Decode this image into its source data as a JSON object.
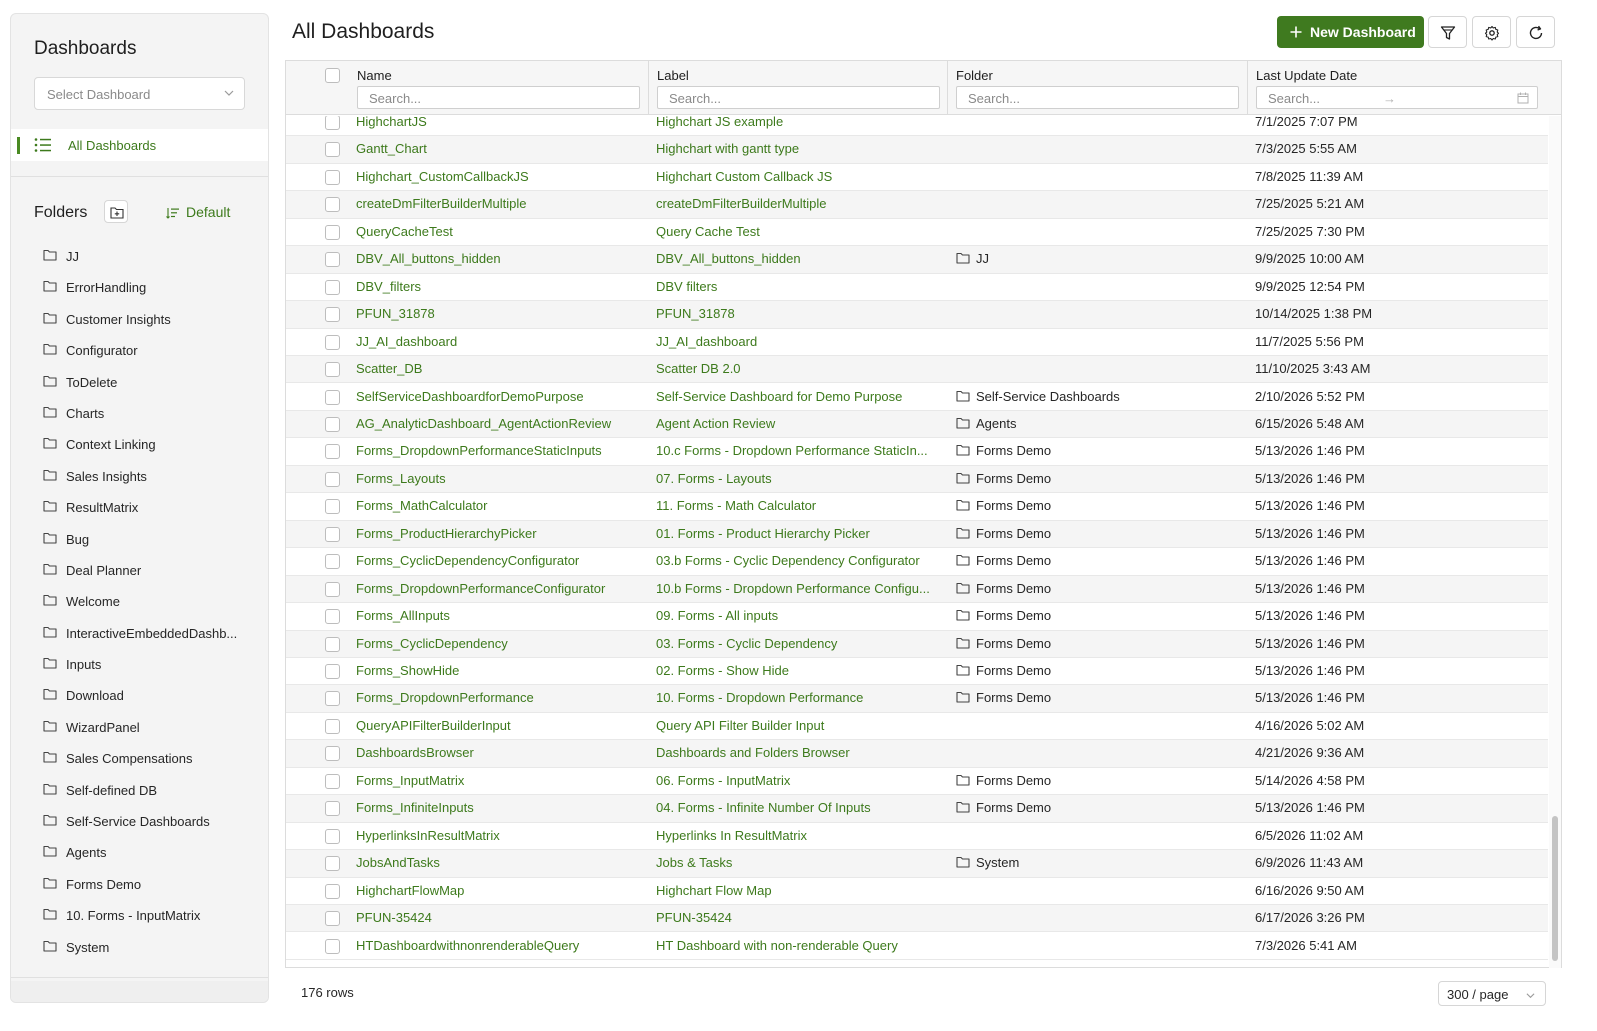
{
  "sidebar": {
    "title": "Dashboards",
    "select_placeholder": "Select Dashboard",
    "all_dashboards_label": "All Dashboards",
    "folders_title": "Folders",
    "sort_label": "Default",
    "folders": [
      "JJ",
      "ErrorHandling",
      "Customer Insights",
      "Configurator",
      "ToDelete",
      "Charts",
      "Context Linking",
      "Sales Insights",
      "ResultMatrix",
      "Bug",
      "Deal Planner",
      "Welcome",
      "InteractiveEmbeddedDashb...",
      "Inputs",
      "Download",
      "WizardPanel",
      "Sales Compensations",
      "Self-defined DB",
      "Self-Service Dashboards",
      "Agents",
      "Forms Demo",
      "10. Forms - InputMatrix",
      "System"
    ]
  },
  "main": {
    "title": "All Dashboards",
    "new_button_label": "New Dashboard",
    "columns": {
      "name": "Name",
      "label": "Label",
      "folder": "Folder",
      "date": "Last Update Date"
    },
    "search_placeholder": "Search...",
    "date_arrow": "→",
    "rows": [
      {
        "name": "HighchartJS",
        "label": "Highchart JS example",
        "folder": "",
        "date": "7/1/2025 7:07 PM"
      },
      {
        "name": "Gantt_Chart",
        "label": "Highchart with gantt type",
        "folder": "",
        "date": "7/3/2025 5:55 AM"
      },
      {
        "name": "Highchart_CustomCallbackJS",
        "label": "Highchart Custom Callback JS",
        "folder": "",
        "date": "7/8/2025 11:39 AM"
      },
      {
        "name": "createDmFilterBuilderMultiple",
        "label": "createDmFilterBuilderMultiple",
        "folder": "",
        "date": "7/25/2025 5:21 AM"
      },
      {
        "name": "QueryCacheTest",
        "label": "Query Cache Test",
        "folder": "",
        "date": "7/25/2025 7:30 PM"
      },
      {
        "name": "DBV_All_buttons_hidden",
        "label": "DBV_All_buttons_hidden",
        "folder": "JJ",
        "date": "9/9/2025 10:00 AM"
      },
      {
        "name": "DBV_filters",
        "label": "DBV filters",
        "folder": "",
        "date": "9/9/2025 12:54 PM"
      },
      {
        "name": "PFUN_31878",
        "label": "PFUN_31878",
        "folder": "",
        "date": "10/14/2025 1:38 PM"
      },
      {
        "name": "JJ_AI_dashboard",
        "label": "JJ_AI_dashboard",
        "folder": "",
        "date": "11/7/2025 5:56 PM"
      },
      {
        "name": "Scatter_DB",
        "label": "Scatter DB 2.0",
        "folder": "",
        "date": "11/10/2025 3:43 AM"
      },
      {
        "name": "SelfServiceDashboardforDemoPurpose",
        "label": "Self-Service Dashboard for Demo Purpose",
        "folder": "Self-Service Dashboards",
        "date": "2/10/2026 5:52 PM"
      },
      {
        "name": "AG_AnalyticDashboard_AgentActionReview",
        "label": "Agent Action Review",
        "folder": "Agents",
        "date": "6/15/2026 5:48 AM"
      },
      {
        "name": "Forms_DropdownPerformanceStaticInputs",
        "label": "10.c Forms - Dropdown Performance StaticIn...",
        "folder": "Forms Demo",
        "date": "5/13/2026 1:46 PM"
      },
      {
        "name": "Forms_Layouts",
        "label": "07. Forms - Layouts",
        "folder": "Forms Demo",
        "date": "5/13/2026 1:46 PM"
      },
      {
        "name": "Forms_MathCalculator",
        "label": "11. Forms - Math Calculator",
        "folder": "Forms Demo",
        "date": "5/13/2026 1:46 PM"
      },
      {
        "name": "Forms_ProductHierarchyPicker",
        "label": "01. Forms - Product Hierarchy Picker",
        "folder": "Forms Demo",
        "date": "5/13/2026 1:46 PM"
      },
      {
        "name": "Forms_CyclicDependencyConfigurator",
        "label": "03.b Forms - Cyclic Dependency Configurator",
        "folder": "Forms Demo",
        "date": "5/13/2026 1:46 PM"
      },
      {
        "name": "Forms_DropdownPerformanceConfigurator",
        "label": "10.b Forms - Dropdown Performance Configu...",
        "folder": "Forms Demo",
        "date": "5/13/2026 1:46 PM"
      },
      {
        "name": "Forms_AllInputs",
        "label": "09. Forms - All inputs",
        "folder": "Forms Demo",
        "date": "5/13/2026 1:46 PM"
      },
      {
        "name": "Forms_CyclicDependency",
        "label": "03. Forms - Cyclic Dependency",
        "folder": "Forms Demo",
        "date": "5/13/2026 1:46 PM"
      },
      {
        "name": "Forms_ShowHide",
        "label": "02. Forms - Show Hide",
        "folder": "Forms Demo",
        "date": "5/13/2026 1:46 PM"
      },
      {
        "name": "Forms_DropdownPerformance",
        "label": "10. Forms - Dropdown Performance",
        "folder": "Forms Demo",
        "date": "5/13/2026 1:46 PM"
      },
      {
        "name": "QueryAPIFilterBuilderInput",
        "label": "Query API Filter Builder Input",
        "folder": "",
        "date": "4/16/2026 5:02 AM"
      },
      {
        "name": "DashboardsBrowser",
        "label": "Dashboards and Folders Browser",
        "folder": "",
        "date": "4/21/2026 9:36 AM"
      },
      {
        "name": "Forms_InputMatrix",
        "label": "06. Forms - InputMatrix",
        "folder": "Forms Demo",
        "date": "5/14/2026 4:58 PM"
      },
      {
        "name": "Forms_InfiniteInputs",
        "label": "04. Forms - Infinite Number Of Inputs",
        "folder": "Forms Demo",
        "date": "5/13/2026 1:46 PM"
      },
      {
        "name": "HyperlinksInResultMatrix",
        "label": "Hyperlinks In ResultMatrix",
        "folder": "",
        "date": "6/5/2026 11:02 AM"
      },
      {
        "name": "JobsAndTasks",
        "label": "Jobs & Tasks",
        "folder": "System",
        "date": "6/9/2026 11:43 AM"
      },
      {
        "name": "HighchartFlowMap",
        "label": "Highchart Flow Map",
        "folder": "",
        "date": "6/16/2026 9:50 AM"
      },
      {
        "name": "PFUN-35424",
        "label": "PFUN-35424",
        "folder": "",
        "date": "6/17/2026 3:26 PM"
      },
      {
        "name": "HTDashboardwithnonrenderableQuery",
        "label": "HT Dashboard with non-renderable Query",
        "folder": "",
        "date": "7/3/2026 5:41 AM"
      }
    ]
  },
  "footer": {
    "rows_count": "176 rows",
    "page_size": "300 / page"
  },
  "colors": {
    "accent": "#3f7a1f",
    "link": "#3d7a1c"
  }
}
